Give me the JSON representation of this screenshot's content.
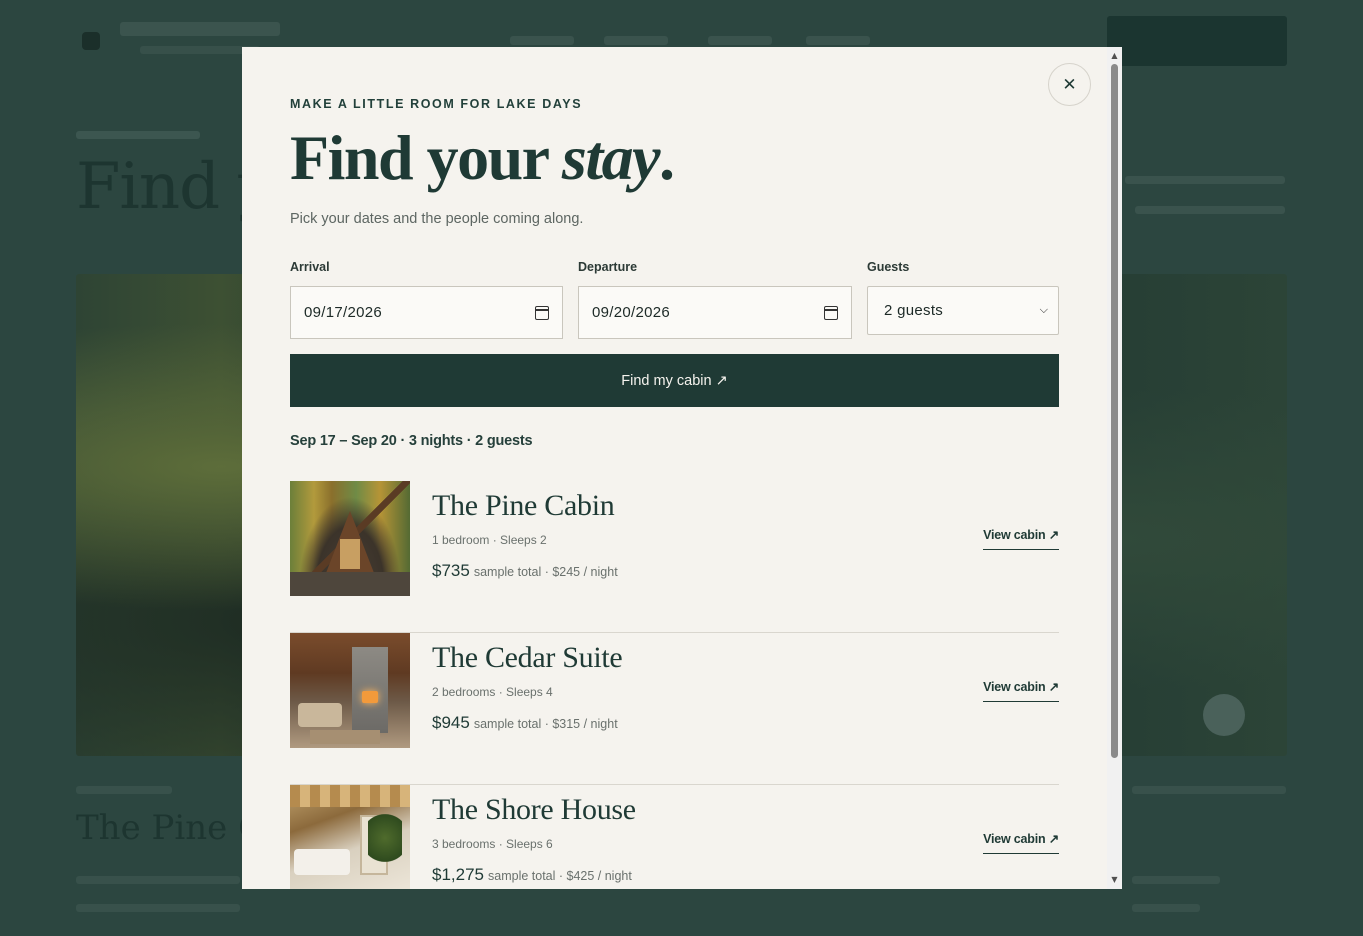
{
  "background": {
    "hero_title": "Find yo",
    "card_title": "The Pine Ca"
  },
  "modal": {
    "kicker": "MAKE A LITTLE ROOM FOR LAKE DAYS",
    "heading_main": "Find your ",
    "heading_emph": "stay",
    "heading_end": ".",
    "subline": "Pick your dates and the people coming along.",
    "close_glyph": "✕",
    "form": {
      "arrival_label": "Arrival",
      "arrival_value": "09/17/2026",
      "departure_label": "Departure",
      "departure_value": "09/20/2026",
      "guests_label": "Guests",
      "guests_value": "2 guests",
      "submit_label": "Find my cabin ↗"
    },
    "summary": "Sep 17 – Sep 20 · 3 nights · 2 guests",
    "results": [
      {
        "name": "The Pine Cabin",
        "meta": "1 bedroom · Sleeps 2",
        "price": "$735",
        "price_note": "sample total · $245 / night",
        "link": "View cabin ↗"
      },
      {
        "name": "The Cedar Suite",
        "meta": "2 bedrooms · Sleeps 4",
        "price": "$945",
        "price_note": "sample total · $315 / night",
        "link": "View cabin ↗"
      },
      {
        "name": "The Shore House",
        "meta": "3 bedrooms · Sleeps 6",
        "price": "$1,275",
        "price_note": "sample total · $425 / night",
        "link": "View cabin ↗"
      }
    ]
  },
  "colors": {
    "accent": "#1f3a35",
    "modal_bg": "#f5f3ee",
    "overlay": "#2c4640"
  }
}
